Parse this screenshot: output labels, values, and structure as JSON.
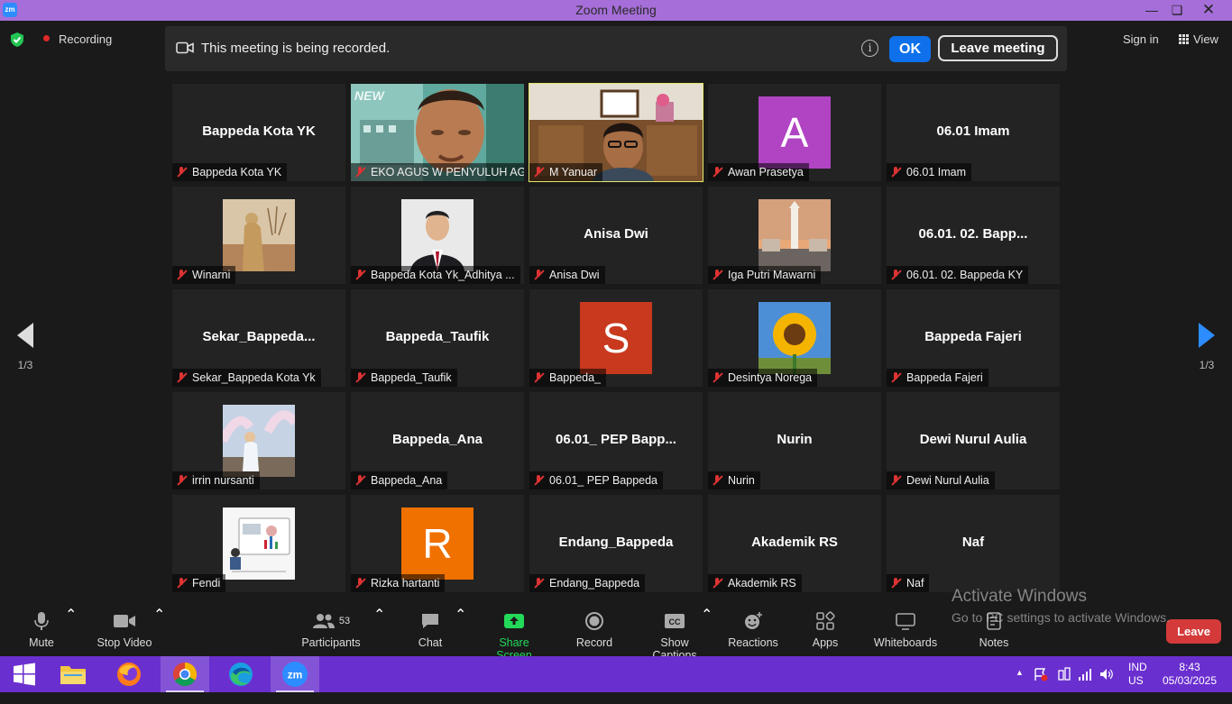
{
  "window": {
    "title": "Zoom Meeting",
    "app_icon": "zm"
  },
  "status": {
    "recording_label": "Recording"
  },
  "banner": {
    "message": "This meeting is being recorded.",
    "info_glyph": "i",
    "ok_label": "OK",
    "leave_label": "Leave meeting"
  },
  "topright": {
    "signin_label": "Sign in",
    "view_label": "View"
  },
  "pager": {
    "left_page": "1/3",
    "right_page": "1/3"
  },
  "tiles": [
    {
      "name": "Bappeda Kota YK",
      "display": "Bappeda Kota YK",
      "kind": "text"
    },
    {
      "name": "EKO AGUS W PENYULUH AGA...",
      "kind": "video"
    },
    {
      "name": "M Yanuar",
      "kind": "video",
      "active": true
    },
    {
      "name": "Awan Prasetya",
      "kind": "avatar",
      "letter": "A",
      "color": "#b144c3"
    },
    {
      "name": "06.01 Imam",
      "display": "06.01 Imam",
      "kind": "text"
    },
    {
      "name": "Winarni",
      "kind": "photo"
    },
    {
      "name": "Bappeda Kota Yk_Adhitya ...",
      "kind": "photo"
    },
    {
      "name": "Anisa Dwi",
      "display": "Anisa Dwi",
      "kind": "text"
    },
    {
      "name": "Iga Putri Mawarni",
      "kind": "photo"
    },
    {
      "name": "06.01. 02. Bappeda KY",
      "display": "06.01. 02. Bapp...",
      "kind": "text"
    },
    {
      "name": "Sekar_Bappeda Kota Yk",
      "display": "Sekar_Bappeda...",
      "kind": "text"
    },
    {
      "name": "Bappeda_Taufik",
      "display": "Bappeda_Taufik",
      "kind": "text"
    },
    {
      "name": "Bappeda_",
      "kind": "avatar",
      "letter": "S",
      "color": "#c8391e"
    },
    {
      "name": "Desintya Norega",
      "kind": "photo"
    },
    {
      "name": "Bappeda Fajeri",
      "display": "Bappeda Fajeri",
      "kind": "text"
    },
    {
      "name": "irrin nursanti",
      "kind": "photo"
    },
    {
      "name": "Bappeda_Ana",
      "display": "Bappeda_Ana",
      "kind": "text"
    },
    {
      "name": "06.01_ PEP Bappeda",
      "display": "06.01_ PEP Bapp...",
      "kind": "text"
    },
    {
      "name": "Nurin",
      "display": "Nurin",
      "kind": "text"
    },
    {
      "name": "Dewi Nurul Aulia",
      "display": "Dewi Nurul Aulia",
      "kind": "text"
    },
    {
      "name": "Fendi",
      "kind": "photo"
    },
    {
      "name": "Rizka hartanti",
      "kind": "avatar",
      "letter": "R",
      "color": "#f07000"
    },
    {
      "name": "Endang_Bappeda",
      "display": "Endang_Bappeda",
      "kind": "text"
    },
    {
      "name": "Akademik RS",
      "display": "Akademik RS",
      "kind": "text"
    },
    {
      "name": "Naf",
      "display": "Naf",
      "kind": "text"
    }
  ],
  "toolbar": {
    "mute": "Mute",
    "stop_video": "Stop Video",
    "participants": "Participants",
    "participants_count": "53",
    "chat": "Chat",
    "share_screen": "Share Screen",
    "record": "Record",
    "show_captions": "Show Captions",
    "reactions": "Reactions",
    "apps": "Apps",
    "whiteboards": "Whiteboards",
    "notes": "Notes",
    "leave": "Leave",
    "share_color": "#23d959"
  },
  "watermark": {
    "line1": "Activate Windows",
    "line2": "Go to PC settings to activate Windows."
  },
  "taskbar": {
    "lang1": "IND",
    "lang2": "US",
    "time": "8:43",
    "date": "05/03/2025"
  }
}
